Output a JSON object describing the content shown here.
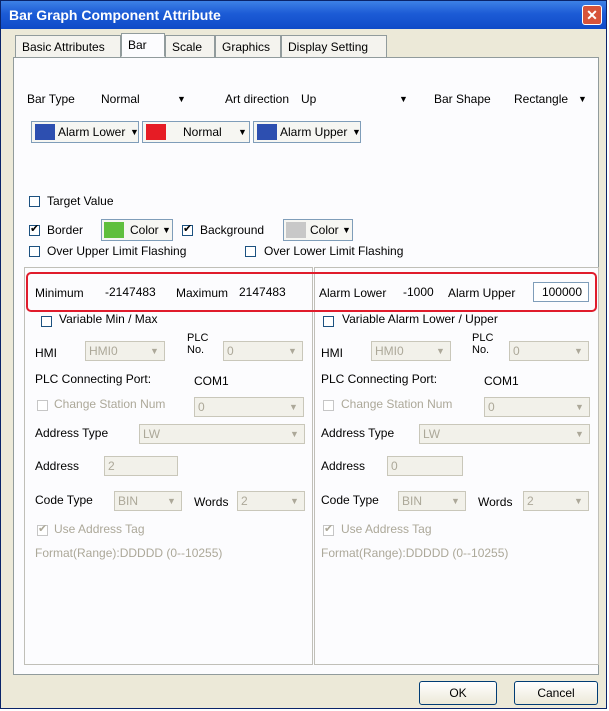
{
  "window": {
    "title": "Bar Graph Component Attribute",
    "close_glyph": "✕"
  },
  "tabs": [
    "Basic Attributes",
    "Bar",
    "Scale",
    "Graphics",
    "Display Setting"
  ],
  "bar": {
    "bar_type_label": "Bar Type",
    "bar_type_value": "Normal",
    "art_direction_label": "Art direction",
    "art_direction_value": "Up",
    "bar_shape_label": "Bar Shape",
    "bar_shape_value": "Rectangle"
  },
  "colors": {
    "alarm_lower": {
      "label": "Alarm Lower",
      "color": "#2d4fb0"
    },
    "normal": {
      "label": "Normal",
      "color": "#e61c25"
    },
    "alarm_upper": {
      "label": "Alarm Upper",
      "color": "#2d4fb0"
    },
    "border_swatch": "#5fbf3c",
    "background_swatch": "#c8c8c8",
    "highlight": "#e01c2c"
  },
  "options": {
    "target_value": "Target Value",
    "border": "Border",
    "color": "Color",
    "background": "Background",
    "over_upper": "Over Upper Limit Flashing",
    "over_lower": "Over Lower Limit Flashing"
  },
  "left": {
    "minimum_label": "Minimum",
    "minimum_value": "-2147483",
    "maximum_label": "Maximum",
    "maximum_value": "2147483",
    "variable_label": "Variable Min / Max"
  },
  "right": {
    "alarm_lower_label": "Alarm Lower",
    "alarm_lower_value": "-1000",
    "alarm_upper_label": "Alarm Upper",
    "alarm_upper_value": "100000",
    "variable_label": "Variable Alarm Lower / Upper"
  },
  "common": {
    "hmi_label": "HMI",
    "hmi_value": "HMI0",
    "plc_no_label_1": "PLC",
    "plc_no_label_2": "No.",
    "plc_no_value": "0",
    "plc_port_label": "PLC Connecting Port:",
    "plc_port_value": "COM1",
    "change_station_label": "Change Station Num",
    "change_station_value": "0",
    "address_type_label": "Address Type",
    "address_type_value": "LW",
    "address_label": "Address",
    "address_value": "2",
    "address_value_right": "0",
    "code_type_label": "Code Type",
    "code_type_value": "BIN",
    "words_label": "Words",
    "words_value": "2",
    "use_tag_label": "Use Address Tag",
    "format_text": "Format(Range):DDDDD (0--10255)"
  },
  "footer": {
    "ok": "OK",
    "cancel": "Cancel"
  }
}
